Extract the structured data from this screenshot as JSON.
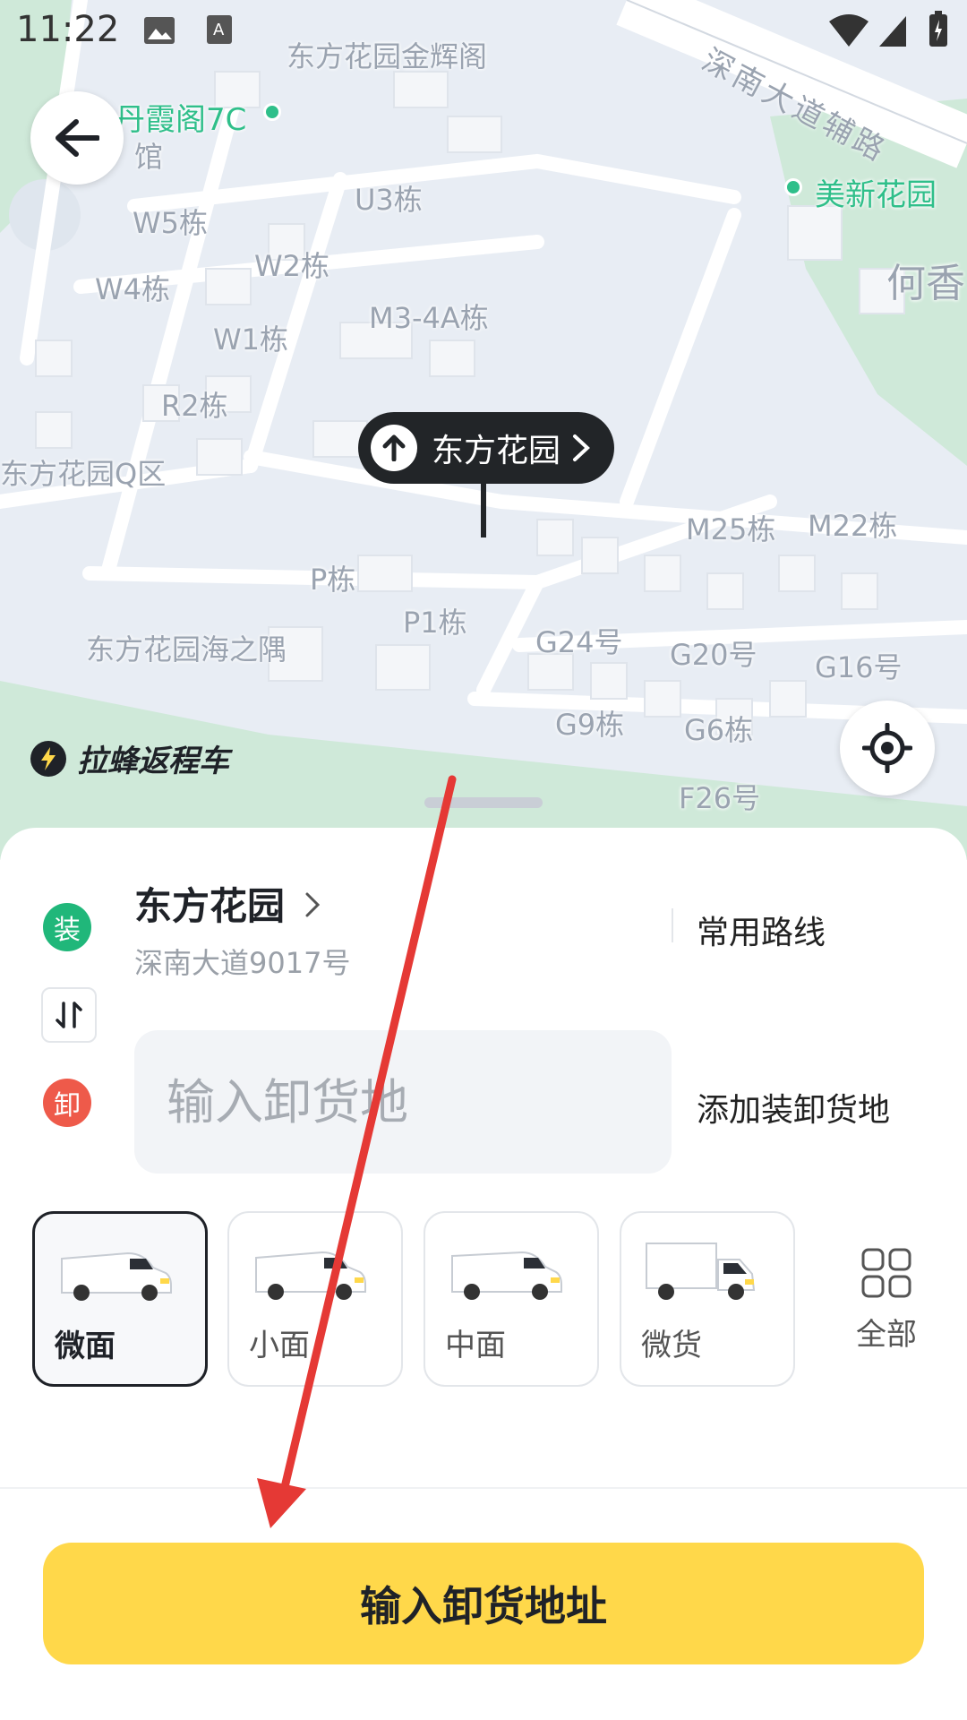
{
  "status_bar": {
    "time": "11:22"
  },
  "map": {
    "poi": [
      {
        "text": "丹霞阁7C"
      },
      {
        "text": "美新花园"
      }
    ],
    "roads": [
      {
        "text": "深南大道辅路"
      }
    ],
    "labels": [
      "东方花园金辉阁",
      "馆",
      "U3栋",
      "W5栋",
      "W2栋",
      "W4栋",
      "M3-4A栋",
      "W1栋",
      "R2栋",
      "东方花园Q区",
      "M25栋",
      "M22栋",
      "P栋",
      "P1栋",
      "G24号",
      "G20号",
      "G16号",
      "东方花园海之隅",
      "G9栋",
      "G6栋",
      "F26号",
      "何香"
    ],
    "pin_label": "东方花园",
    "brand": "拉蜂返程车"
  },
  "route": {
    "origin": {
      "badge": "装",
      "title": "东方花园",
      "subtitle": "深南大道9017号"
    },
    "destination": {
      "badge": "卸",
      "placeholder": "输入卸货地"
    },
    "common_routes": "常用路线",
    "add_stop": "添加装卸货地"
  },
  "vehicles": [
    {
      "label": "微面",
      "selected": true
    },
    {
      "label": "小面",
      "selected": false
    },
    {
      "label": "中面",
      "selected": false
    },
    {
      "label": "微货",
      "selected": false
    }
  ],
  "all_label": "全部",
  "cta_label": "输入卸货地址",
  "colors": {
    "cta": "#ffd84a",
    "load_badge": "#20b77a",
    "unload_badge": "#ee5a4a",
    "annotation_arrow": "#e53935"
  }
}
